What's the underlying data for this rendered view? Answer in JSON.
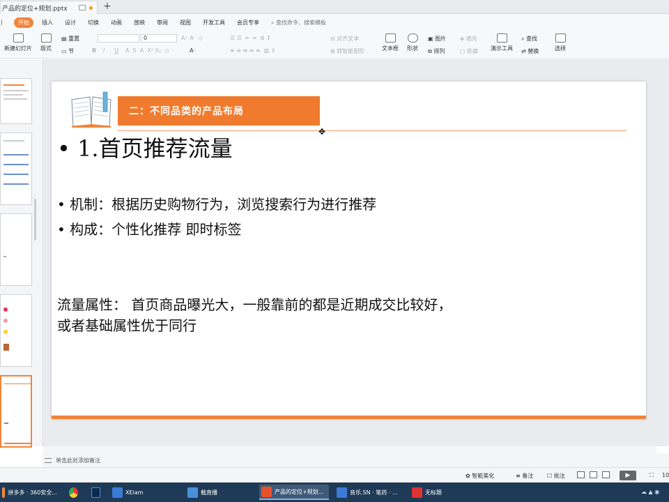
{
  "window": {
    "doc_tab_title": "产品的定位+规划.pptx",
    "new_tab": "+"
  },
  "menu": {
    "items": [
      "开始",
      "插入",
      "设计",
      "切换",
      "动画",
      "放映",
      "审阅",
      "视图",
      "开发工具",
      "会员专享"
    ],
    "search_placeholder": "查找命令、搜索模板"
  },
  "ribbon": {
    "new_slide": "新建幻灯片",
    "layout": "版式",
    "reset": "重置",
    "section": "节",
    "font_size": "0",
    "text_box": "文本框",
    "shape": "形状",
    "picture": "图片",
    "arrange": "排列",
    "fill": "填充",
    "outline": "轮廓",
    "align_text": "对齐文本",
    "convert_smartart": "转智能图形",
    "presenter_tools": "演示工具",
    "find": "查找",
    "replace": "替换",
    "select": "选择"
  },
  "slide": {
    "title": "二：不同品类的产品布局",
    "heading": "1.首页推荐流量",
    "bullets": [
      "机制：根据历史购物行为，浏览搜索行为进行推荐",
      "构成：个性化推荐 即时标签"
    ],
    "paragraph_line1": "流量属性： 首页商品曝光大，一般靠前的都是近期成交比较好，",
    "paragraph_line2": "或者基础属性优于同行"
  },
  "notes": {
    "placeholder": "单击此处添加备注"
  },
  "statusbar": {
    "smart_beautify": "智能美化",
    "notes_btn": "备注",
    "comment_btn": "批注",
    "zoom": "10"
  },
  "taskbar": {
    "items": [
      "拼多多 · 360安全...",
      "XEiam",
      "截直播",
      "产品的定位+规划...",
      "音乐.SN · 笔药 · ...",
      "无标题"
    ]
  },
  "colors": {
    "accent_orange": "#f07b2e",
    "taskbar": "#1f3a57",
    "ribbon_bg": "#f7f8fa"
  }
}
